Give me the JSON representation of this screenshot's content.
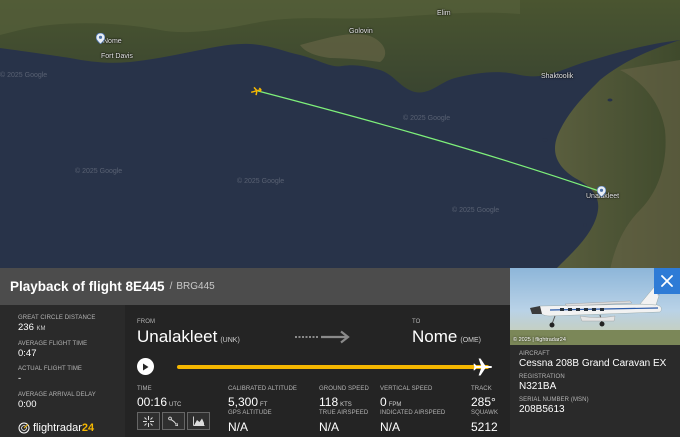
{
  "map": {
    "places": {
      "nome": "Nome",
      "fort_davis": "Fort Davis",
      "elim": "Elim",
      "golovin": "Golovin",
      "shaktoolik": "Shaktoolik",
      "unalakleet": "Unalakleet"
    },
    "watermarks": [
      "© 2025 Google",
      "© 2025 Google",
      "© 2025 Google",
      "© 2025 Google",
      "© 2025 Google"
    ],
    "track_color": "#7ef07a",
    "water_color": "#283349"
  },
  "header": {
    "title": "Playback of flight 8E445",
    "separator": "/",
    "callsign": "BRG445"
  },
  "photo": {
    "copyright": "© 2025 | flightradar24"
  },
  "left_panel": {
    "great_circle_distance_label": "GREAT CIRCLE DISTANCE",
    "great_circle_distance_value": "236",
    "great_circle_distance_unit": "KM",
    "avg_flight_time_label": "AVERAGE FLIGHT TIME",
    "avg_flight_time_value": "0:47",
    "actual_flight_time_label": "ACTUAL FLIGHT TIME",
    "actual_flight_time_value": "-",
    "avg_arrival_delay_label": "AVERAGE ARRIVAL DELAY",
    "avg_arrival_delay_value": "0:00",
    "logo_text": "flightradar",
    "logo_suffix": "24"
  },
  "route": {
    "from_label": "FROM",
    "from_city": "Unalakleet",
    "from_code": "(UNK)",
    "to_label": "TO",
    "to_city": "Nome",
    "to_code": "(OME)"
  },
  "playback": {
    "progress": 1.0,
    "accent_color": "#f5b700"
  },
  "stats": {
    "time_label": "TIME",
    "time_value": "00:16",
    "time_unit": "UTC",
    "calibrated_altitude_label": "CALIBRATED ALTITUDE",
    "calibrated_altitude_value": "5,300",
    "calibrated_altitude_unit": "FT",
    "gps_altitude_label": "GPS ALTITUDE",
    "gps_altitude_value": "N/A",
    "ground_speed_label": "GROUND SPEED",
    "ground_speed_value": "118",
    "ground_speed_unit": "KTS",
    "true_airspeed_label": "TRUE AIRSPEED",
    "true_airspeed_value": "N/A",
    "vertical_speed_label": "VERTICAL SPEED",
    "vertical_speed_value": "0",
    "vertical_speed_unit": "FPM",
    "indicated_airspeed_label": "INDICATED AIRSPEED",
    "indicated_airspeed_value": "N/A",
    "track_label": "TRACK",
    "track_value": "285°",
    "squawk_label": "SQUAWK",
    "squawk_value": "5212"
  },
  "aircraft": {
    "aircraft_label": "AIRCRAFT",
    "aircraft_value": "Cessna 208B Grand Caravan EX",
    "registration_label": "REGISTRATION",
    "registration_value": "N321BA",
    "serial_label": "SERIAL NUMBER (MSN)",
    "serial_value": "208B5613"
  },
  "icons": {
    "play": "play-icon",
    "close": "close-icon",
    "arrow": "route-arrow-icon",
    "plane": "airplane-icon",
    "tools": [
      "crosshair-icon",
      "route-icon",
      "altitude-chart-icon"
    ]
  }
}
